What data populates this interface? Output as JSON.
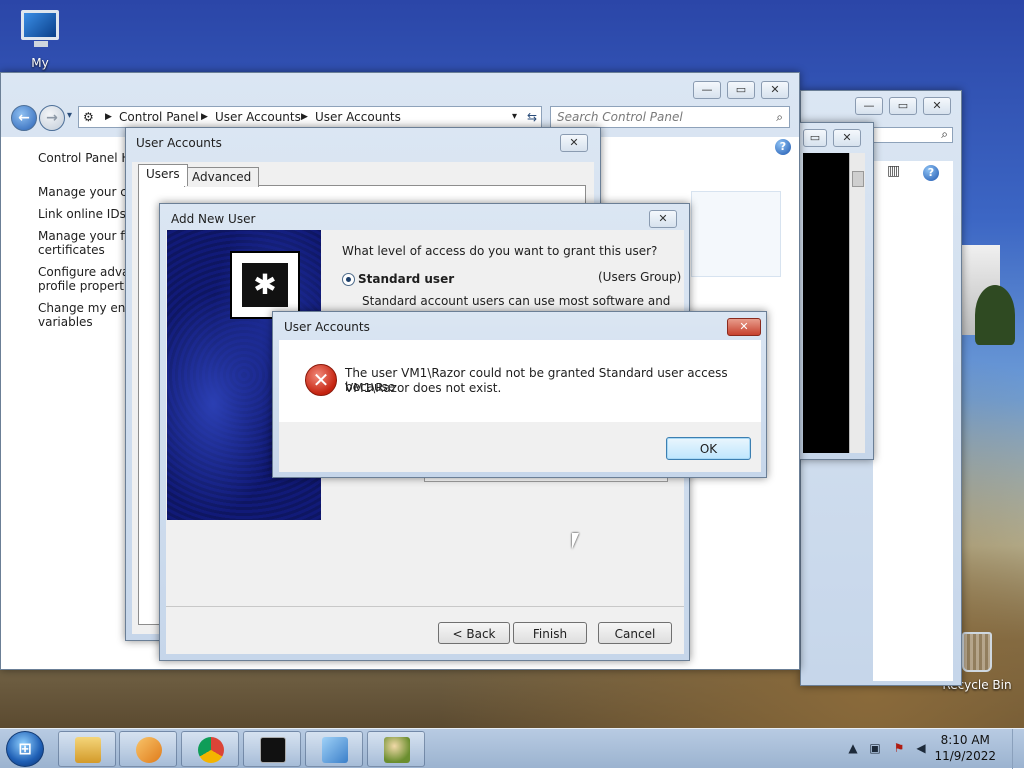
{
  "desktop": {
    "my_computer_label": "My Computer",
    "recycle_bin_label": "Recycle Bin"
  },
  "control_panel": {
    "breadcrumb": [
      "Control Panel",
      "User Accounts",
      "User Accounts"
    ],
    "search_placeholder": "Search Control Panel",
    "help_glyph": "?",
    "left_nav": [
      "Control Panel Ho",
      "Manage your cre",
      "Link online IDs",
      "Manage your file",
      "certificates",
      "Configure advan",
      "profile properties",
      "Change my envi",
      "variables"
    ]
  },
  "user_accounts_dialog": {
    "title": "User Accounts",
    "tabs": [
      "Users",
      "Advanced"
    ]
  },
  "add_new_user": {
    "title": "Add New User",
    "question": "What level of access do you want to grant this user?",
    "option_label": "Standard user",
    "option_group": "(Users Group)",
    "option_description": "Standard account users can use most software and",
    "buttons": {
      "back": "< Back",
      "finish": "Finish",
      "cancel": "Cancel"
    }
  },
  "error_dialog": {
    "title": "User Accounts",
    "message_line1": "The user VM1\\Razor could not be granted Standard user access because",
    "message_line2": "VM1\\Razor does not exist.",
    "ok_label": "OK",
    "close_glyph": "✕",
    "error_glyph": "✕"
  },
  "taskbar": {
    "time": "8:10 AM",
    "date": "11/9/2022",
    "start_glyph": "⊞",
    "pinned": [
      "file-explorer-icon",
      "media-player-icon",
      "chrome-icon",
      "command-prompt-icon",
      "control-panel-icon",
      "user-accounts-icon"
    ]
  },
  "glyphs": {
    "minimize": "—",
    "maximize": "▭",
    "close": "✕",
    "back_arrow": "←",
    "forward_arrow": "→",
    "refresh": "⇆",
    "search": "⌕",
    "dropdown": "▾",
    "tray_up": "▲",
    "banner_asterisk": "✱"
  },
  "colors": {
    "taskbar": "#a6bcd6",
    "dialog_bg": "#f0f0f0",
    "error_red": "#c4220f",
    "banner_blue": "#111a78"
  }
}
